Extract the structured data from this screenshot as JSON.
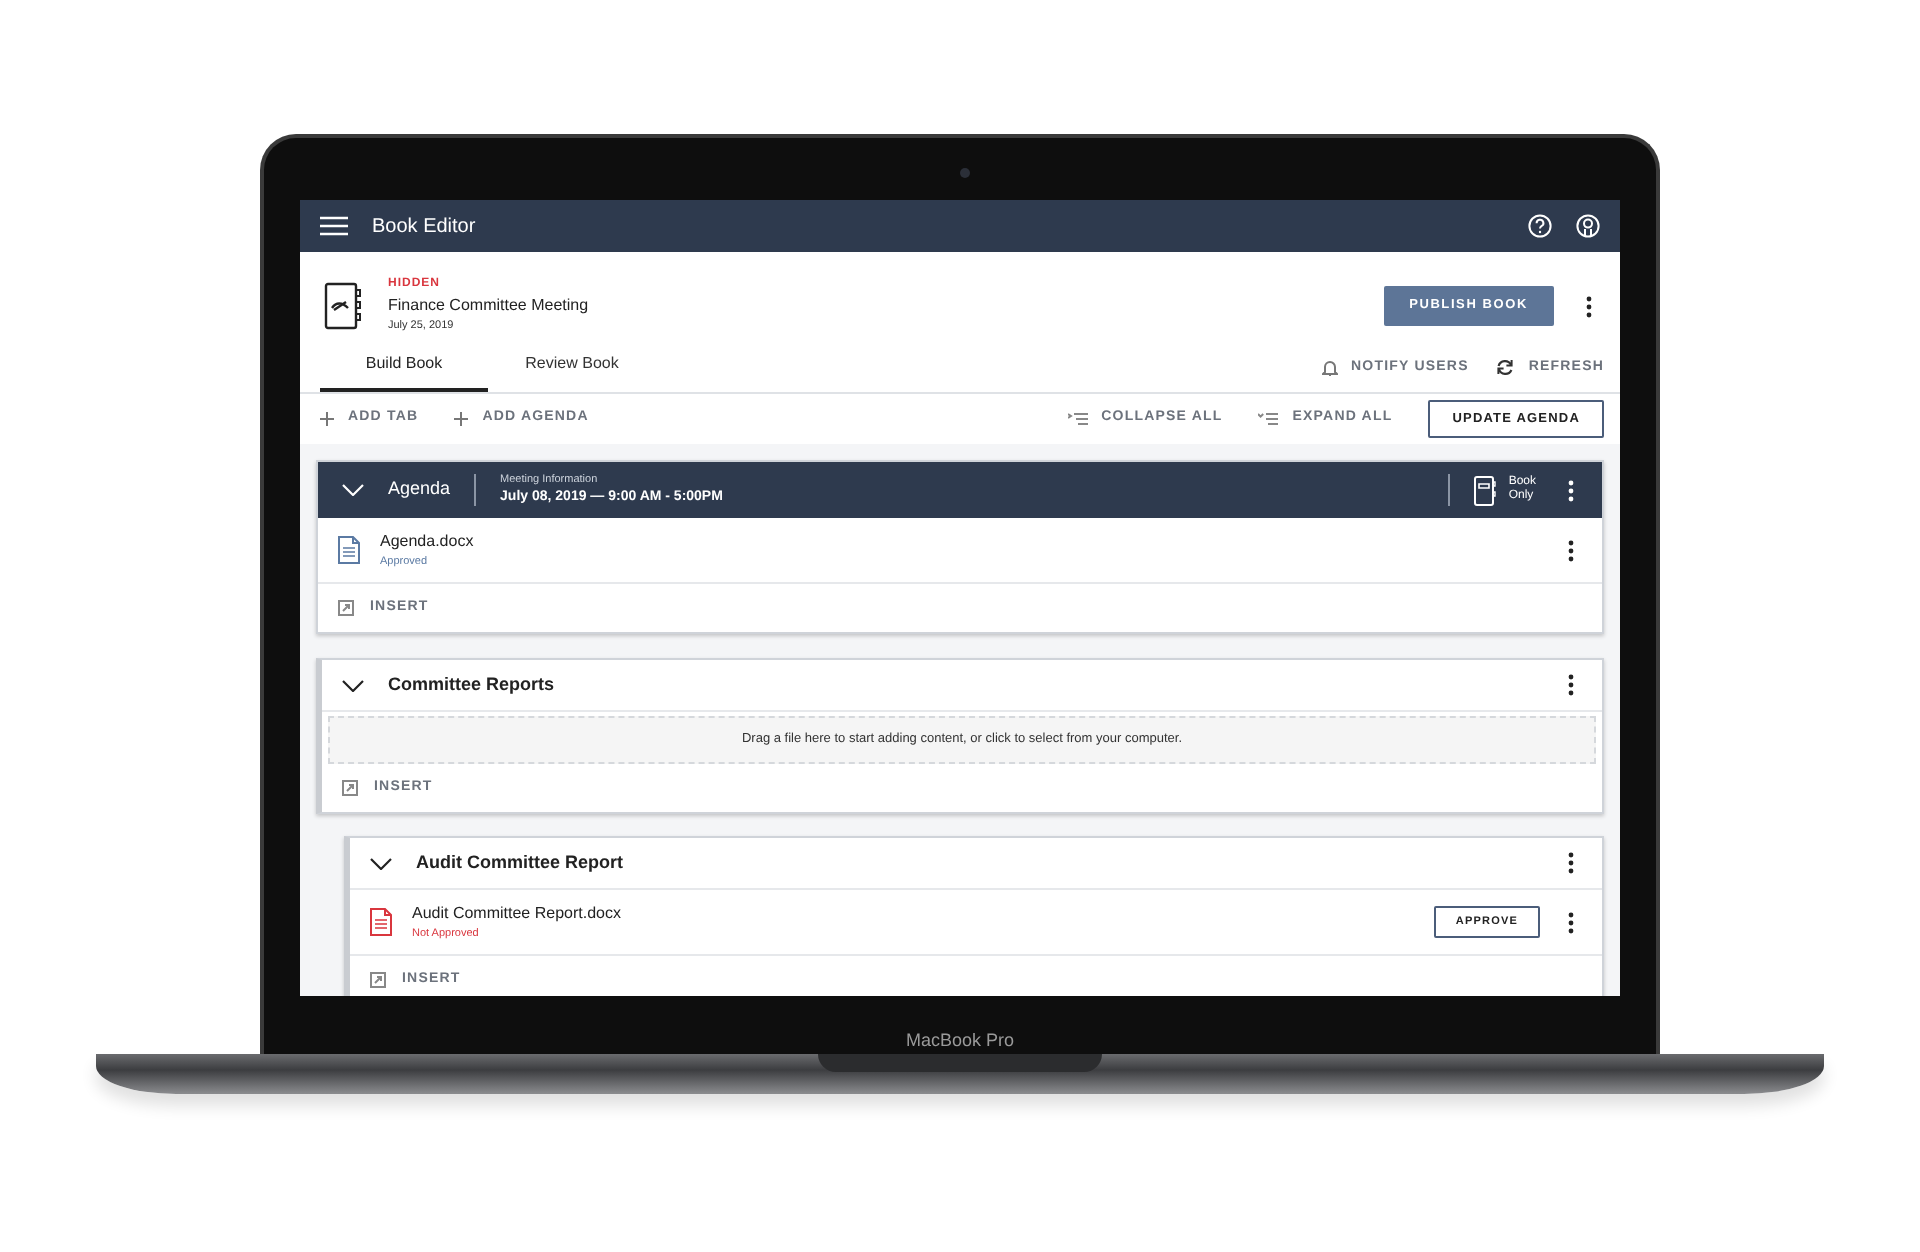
{
  "device": {
    "label": "MacBook Pro"
  },
  "app_bar": {
    "title": "Book Editor"
  },
  "book": {
    "status": "HIDDEN",
    "title": "Finance Committee Meeting",
    "date": "July 25, 2019",
    "publish_button": "PUBLISH BOOK"
  },
  "tabs": [
    {
      "label": "Build Book",
      "selected": true
    },
    {
      "label": "Review Book",
      "selected": false
    }
  ],
  "tab_actions": [
    {
      "kind": "notify",
      "label": "NOTIFY USERS"
    },
    {
      "kind": "refresh",
      "label": "REFRESH"
    }
  ],
  "toolbar": {
    "left": [
      {
        "kind": "add",
        "label": "ADD TAB"
      },
      {
        "kind": "add",
        "label": "ADD AGENDA"
      }
    ],
    "right": [
      {
        "kind": "collapse",
        "label": "COLLAPSE ALL"
      },
      {
        "kind": "expand",
        "label": "EXPAND ALL"
      }
    ],
    "update_button": "UPDATE AGENDA"
  },
  "sections": [
    {
      "kind": "agenda",
      "title": "Agenda",
      "meeting_label": "Meeting Information",
      "meeting_time": "July 08, 2019 — 9:00 AM - 5:00PM",
      "book_only": [
        "Book",
        "Only"
      ],
      "files": [
        {
          "name": "Agenda.docx",
          "status": "Approved",
          "approved": true
        }
      ],
      "insert": "INSERT"
    },
    {
      "kind": "tab",
      "title": "Committee Reports",
      "dropzone": "Drag a file here to start adding content, or click to select from your computer.",
      "insert": "INSERT",
      "children": [
        {
          "kind": "tab",
          "title": "Audit Committee Report",
          "files": [
            {
              "name": "Audit Committee Report.docx",
              "status": "Not Approved",
              "approved": false,
              "action": "APPROVE"
            }
          ],
          "insert": "INSERT"
        }
      ]
    }
  ]
}
